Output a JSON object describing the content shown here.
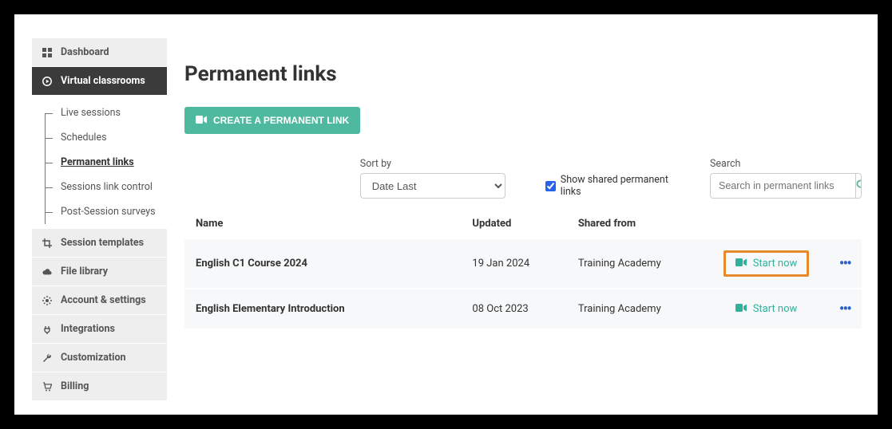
{
  "sidebar": {
    "items": [
      {
        "label": "Dashboard"
      },
      {
        "label": "Virtual classrooms"
      },
      {
        "label": "Session templates"
      },
      {
        "label": "File library"
      },
      {
        "label": "Account & settings"
      },
      {
        "label": "Integrations"
      },
      {
        "label": "Customization"
      },
      {
        "label": "Billing"
      }
    ],
    "sub_items": [
      {
        "label": "Live sessions"
      },
      {
        "label": "Schedules"
      },
      {
        "label": "Permanent links"
      },
      {
        "label": "Sessions link control"
      },
      {
        "label": "Post-Session surveys"
      }
    ]
  },
  "page": {
    "title": "Permanent links",
    "create_label": "CREATE A PERMANENT LINK"
  },
  "controls": {
    "sort_label": "Sort by",
    "sort_value": "Date Last",
    "show_shared_label": "Show shared permanent links",
    "show_shared_checked": true,
    "search_label": "Search",
    "search_placeholder": "Search in permanent links"
  },
  "columns": {
    "name": "Name",
    "updated": "Updated",
    "shared": "Shared from"
  },
  "rows": [
    {
      "name": "English C1 Course 2024",
      "updated": "19 Jan 2024",
      "shared": "Training Academy",
      "action": "Start now"
    },
    {
      "name": "English Elementary Introduction",
      "updated": "08 Oct 2023",
      "shared": "Training Academy",
      "action": "Start now"
    }
  ]
}
